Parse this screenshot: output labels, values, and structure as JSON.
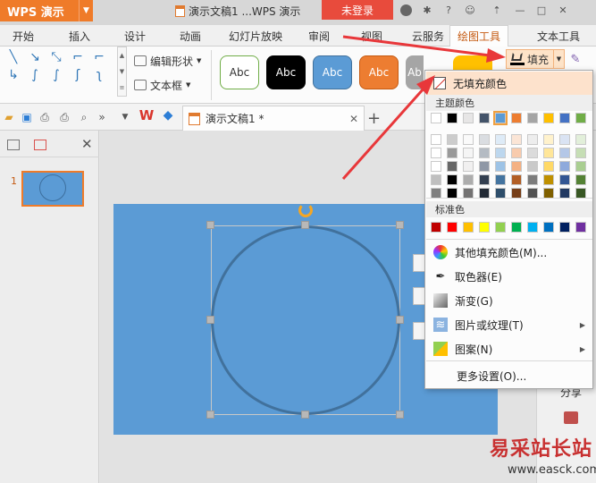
{
  "app": {
    "logo_text": "WPS 演示",
    "doc_title": "演示文稿1 ...WPS 演示",
    "login_label": "未登录"
  },
  "menu": {
    "items": [
      "开始",
      "插入",
      "设计",
      "动画",
      "幻灯片放映",
      "审阅",
      "视图",
      "云服务",
      "绘图工具",
      "文本工具"
    ],
    "active": "绘图工具"
  },
  "ribbon": {
    "edit_shape": "编辑形状",
    "text_box": "文本框",
    "styles": [
      "Abc",
      "Abc",
      "Abc",
      "Abc",
      "Ab"
    ],
    "fill_label": "填充"
  },
  "tabs": {
    "doc_tab": "演示文稿1 *"
  },
  "slides": {
    "number": "1"
  },
  "dropdown": {
    "no_fill": "无填充颜色",
    "theme_colors": "主题颜色",
    "standard_colors": "标准色",
    "more_fill": "其他填充颜色(M)...",
    "eyedropper": "取色器(E)",
    "gradient": "渐变(G)",
    "picture_texture": "图片或纹理(T)",
    "pattern": "图案(N)",
    "more_settings": "更多设置(O)..."
  },
  "right_panel": {
    "share": "分享"
  },
  "watermark": {
    "title": "易采站长站",
    "url": "www.easck.com"
  },
  "colors": {
    "accent": "#ef7b29",
    "slide_bg": "#5b9bd5",
    "circle_stroke": "#41719c",
    "arrow": "#e8373a",
    "theme_row": [
      "#ffffff",
      "#000000",
      "#e7e6e6",
      "#44546a",
      "#5b9bd5",
      "#ed7d31",
      "#a5a5a5",
      "#ffc000",
      "#4472c4",
      "#70ad47"
    ],
    "standard_row": [
      "#c00000",
      "#ff0000",
      "#ffc000",
      "#ffff00",
      "#92d050",
      "#00b050",
      "#00b0f0",
      "#0070c0",
      "#002060",
      "#7030a0"
    ]
  }
}
